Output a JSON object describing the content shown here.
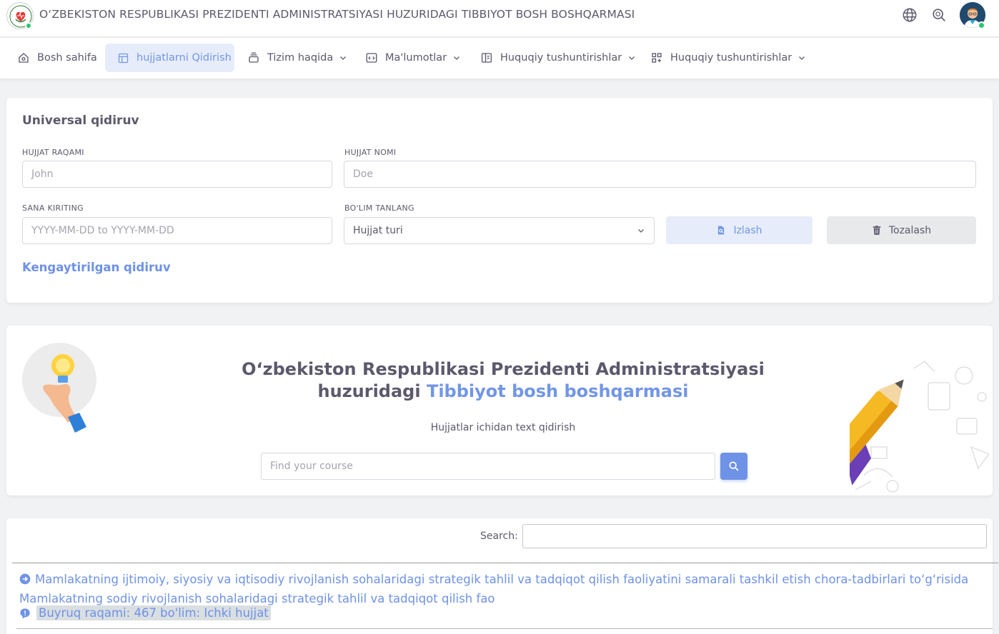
{
  "header": {
    "title": "O‘ZBEKISTON RESPUBLIKASI PREZIDENTI ADMINISTRATSIYASI HUZURIDAGI TIBBIYOT BOSH BOSHQARMASI"
  },
  "nav": {
    "items": [
      {
        "label": "Bosh sahifa",
        "icon": "home-icon"
      },
      {
        "label": "hujjatlarni Qidirish",
        "icon": "layout-icon",
        "active": true
      },
      {
        "label": "Tizim haqida",
        "icon": "stack-icon"
      },
      {
        "label": "Ma'lumotlar",
        "icon": "code-window-icon"
      },
      {
        "label": "Huquqiy tushuntirishlar",
        "icon": "book-icon"
      },
      {
        "label": "Huquqiy tushuntirishlar",
        "icon": "grid-plus-icon"
      }
    ]
  },
  "universal": {
    "title": "Universal qidiruv",
    "doc_number_label": "HUJJAT RAQAMI",
    "doc_number_placeholder": "John",
    "doc_name_label": "HUJJAT NOMI",
    "doc_name_placeholder": "Doe",
    "date_label": "SANA KIRITING",
    "date_placeholder": "YYYY-MM-DD to YYYY-MM-DD",
    "section_label": "BO'LIM TANLANG",
    "section_value": "Hujjat turi",
    "search_button": "Izlash",
    "clear_button": "Tozalash",
    "advanced_link": "Kengaytirilgan qidiruv"
  },
  "hero": {
    "title_line1": "O‘zbekiston Respublikasi Prezidenti Administratsiyasi",
    "title_line2_prefix": "huzuridagi ",
    "title_line2_highlight": "Tibbiyot bosh boshqarmasi",
    "subtitle": "Hujjatlar ichidan text qidirish",
    "search_placeholder": "Find your course"
  },
  "results": {
    "search_label": "Search:",
    "items": [
      {
        "title": "Mamlakatning ijtimoiy, siyosiy va iqtisodiy rivojlanish sohalaridagi strategik tahlil va tadqiqot qilish faoliyatini samarali tashkil etish chora-tadbirlari to‘g‘risida Mamlakatning sodiy rivojlanish sohalaridagi strategik tahlil va tadqiqot qilish fao",
        "meta": "Buyruq raqami: 467 bo'lim: Ichki hujjat"
      }
    ]
  },
  "colors": {
    "accent": "#7296e6",
    "text": "#5d596c",
    "online": "#28c76f"
  }
}
